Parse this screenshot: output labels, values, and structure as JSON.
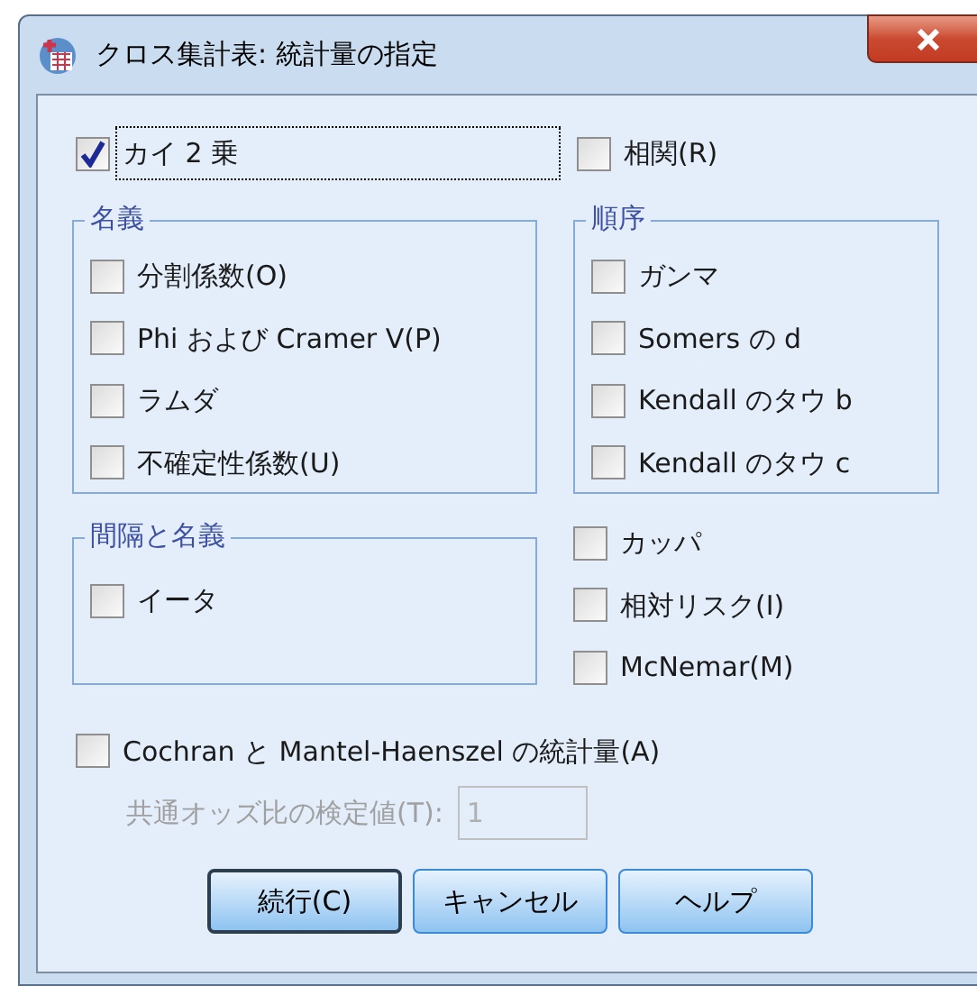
{
  "window": {
    "title": "クロス集計表: 統計量の指定"
  },
  "top_options": [
    {
      "label": "カイ 2 乗",
      "checked": true,
      "focused": true
    },
    {
      "label": "相関(R)",
      "checked": false,
      "focused": false
    }
  ],
  "nominal": {
    "title": "名義",
    "options": [
      {
        "label": "分割係数(O)",
        "checked": false
      },
      {
        "label": "Phi および Cramer V(P)",
        "checked": false
      },
      {
        "label": "ラムダ",
        "checked": false
      },
      {
        "label": "不確定性係数(U)",
        "checked": false
      }
    ]
  },
  "ordinal": {
    "title": "順序",
    "options": [
      {
        "label": "ガンマ",
        "checked": false
      },
      {
        "label": "Somers の d",
        "checked": false
      },
      {
        "label": "Kendall のタウ b",
        "checked": false
      },
      {
        "label": "Kendall のタウ c",
        "checked": false
      }
    ]
  },
  "interval_nominal": {
    "title": "間隔と名義",
    "options": [
      {
        "label": "イータ",
        "checked": false
      }
    ]
  },
  "other_options": [
    {
      "label": "カッパ",
      "checked": false
    },
    {
      "label": "相対リスク(I)",
      "checked": false
    },
    {
      "label": "McNemar(M)",
      "checked": false
    }
  ],
  "cmh": {
    "label": "Cochran と Mantel-Haenszel の統計量(A)",
    "checked": false
  },
  "odds_ratio": {
    "label": "共通オッズ比の検定値(T):",
    "value": "1",
    "disabled": true
  },
  "buttons": [
    {
      "label": "続行(C)",
      "default": true
    },
    {
      "label": "キャンセル",
      "default": false
    },
    {
      "label": "ヘルプ",
      "default": false
    }
  ]
}
